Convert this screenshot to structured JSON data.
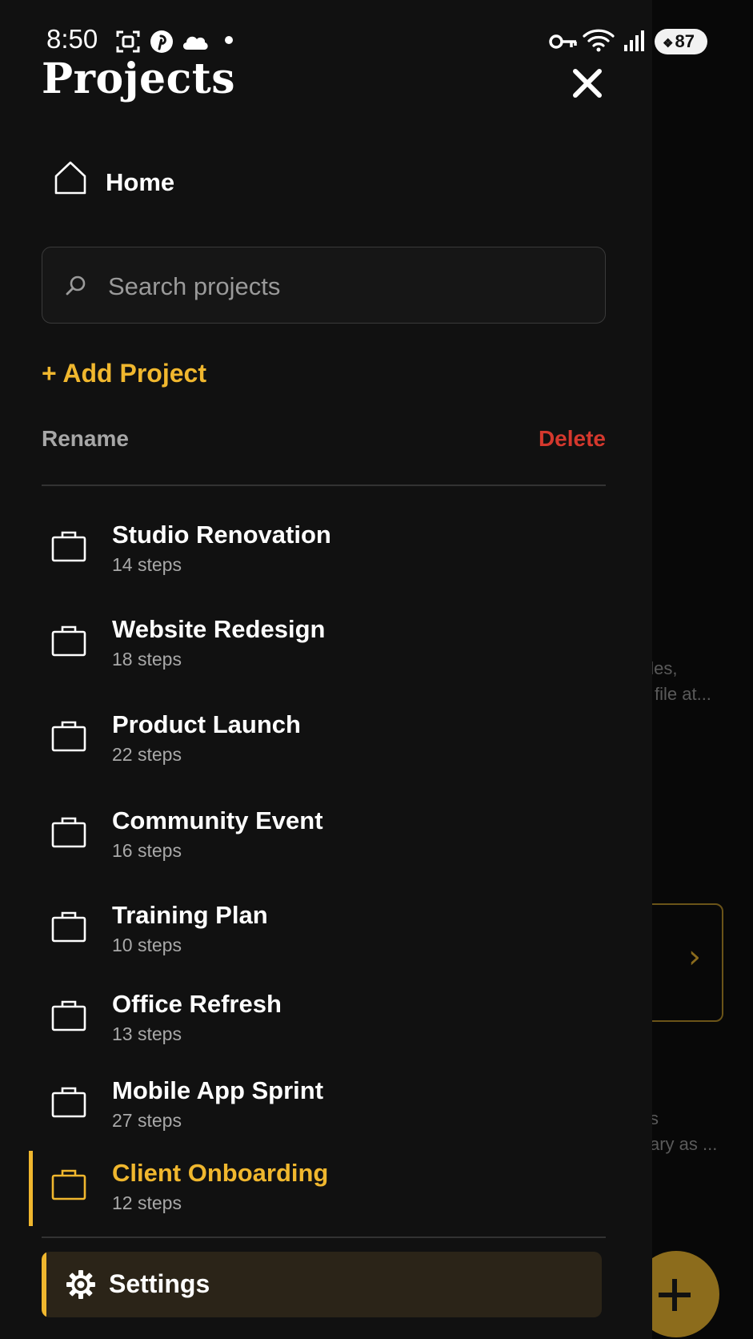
{
  "status_bar": {
    "time": "8:50",
    "battery": "87"
  },
  "drawer": {
    "title": "Projects"
  },
  "nav": {
    "home_label": "Home"
  },
  "search": {
    "placeholder": "Search projects",
    "value": ""
  },
  "actions": {
    "add_project": "+ Add Project",
    "rename": "Rename",
    "delete": "Delete"
  },
  "projects": [
    {
      "name": "Studio Renovation",
      "steps": "14 steps",
      "active": false
    },
    {
      "name": "Website Redesign",
      "steps": "18 steps",
      "active": false
    },
    {
      "name": "Product Launch",
      "steps": "22 steps",
      "active": false
    },
    {
      "name": "Community Event",
      "steps": "16 steps",
      "active": false
    },
    {
      "name": "Training Plan",
      "steps": "10 steps",
      "active": false
    },
    {
      "name": "Office Refresh",
      "steps": "13 steps",
      "active": false
    },
    {
      "name": "Mobile App Sprint",
      "steps": "27 steps",
      "active": false
    },
    {
      "name": "Client Onboarding",
      "steps": "12 steps",
      "active": true
    }
  ],
  "settings": {
    "label": "Settings"
  },
  "background": {
    "snippet_1a": "nles,",
    "snippet_1b": "file at...",
    "snippet_2a": "s",
    "snippet_2b": "ary as ..."
  },
  "colors": {
    "accent": "#f0b72e",
    "danger": "#d4382d",
    "drawer_bg": "#111111",
    "text_primary": "#ffffff",
    "text_secondary": "#a9a9a9"
  }
}
